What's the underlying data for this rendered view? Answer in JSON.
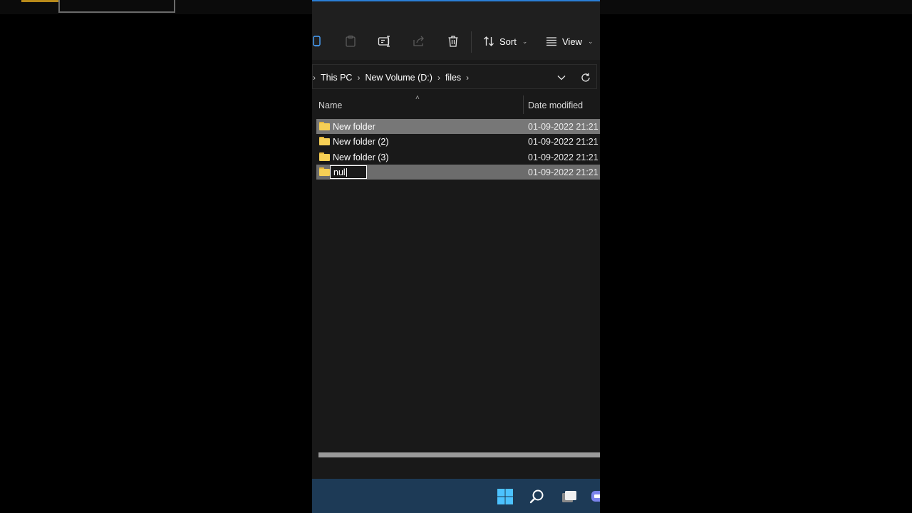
{
  "toolbar": {
    "icons": [
      "copy-icon",
      "paste-icon",
      "rename-icon",
      "share-icon",
      "delete-icon"
    ],
    "sort_label": "Sort",
    "view_label": "View"
  },
  "breadcrumb": {
    "items": [
      "This PC",
      "New Volume (D:)",
      "files"
    ]
  },
  "list": {
    "columns": [
      "Name",
      "Date modified"
    ],
    "rows": [
      {
        "name": "New folder",
        "date": "01-09-2022 21:21"
      },
      {
        "name": "New folder (2)",
        "date": "01-09-2022 21:21"
      },
      {
        "name": "New folder (3)",
        "date": "01-09-2022 21:21"
      },
      {
        "name": "nul",
        "date": "01-09-2022 21:21"
      }
    ]
  },
  "rename": {
    "value": "nul"
  },
  "colors": {
    "accent": "#2a7fd6",
    "folder": "#f6cf55",
    "selection": "#777777",
    "taskbar": "#1d3a56"
  },
  "taskbar": {
    "icons": [
      "windows-start-icon",
      "search-icon",
      "task-view-icon",
      "teams-chat-icon"
    ]
  }
}
